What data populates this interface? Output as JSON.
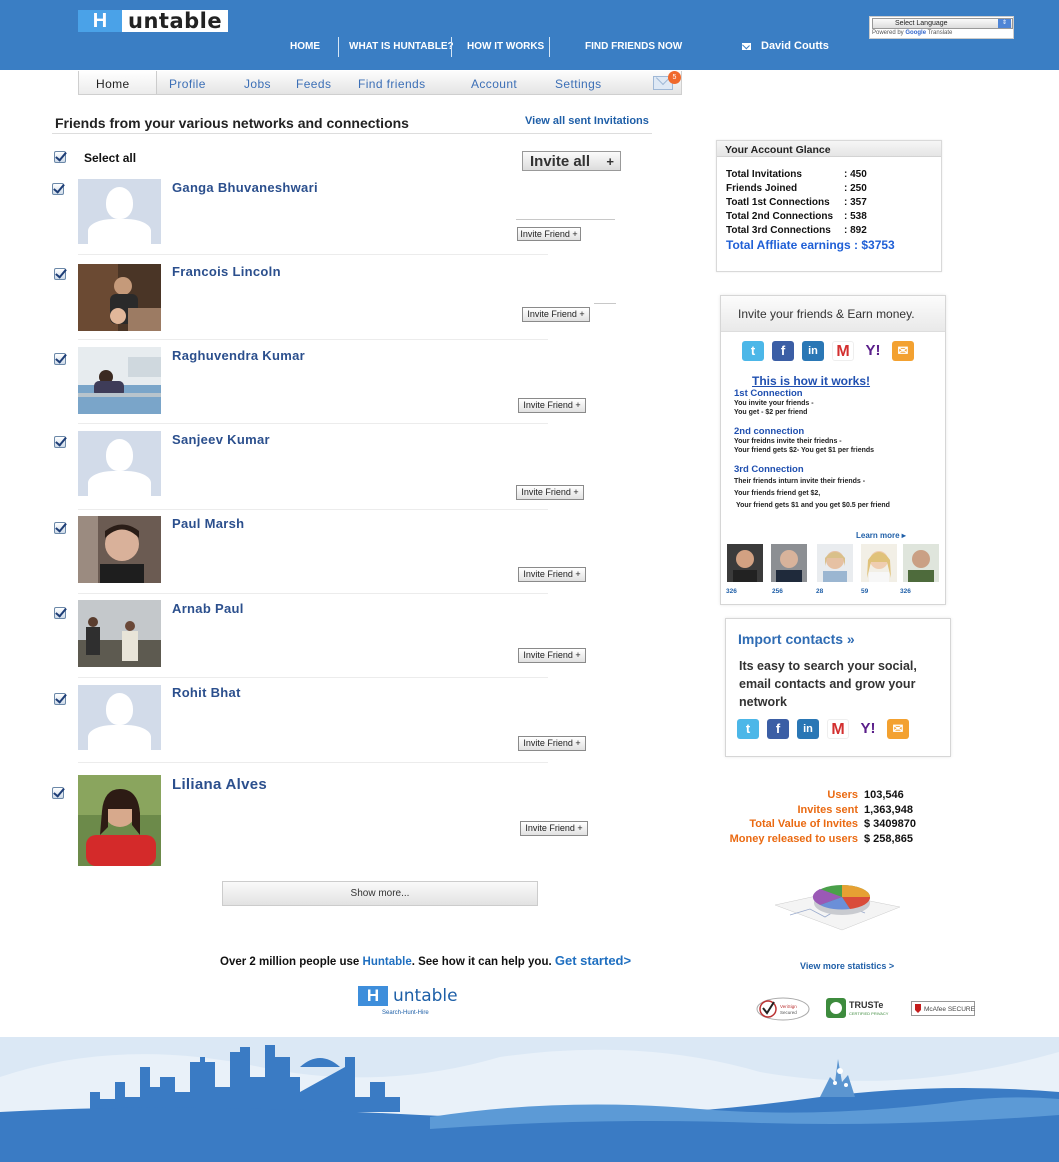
{
  "header": {
    "logo_letter": "H",
    "logo_word": "untable",
    "nav": [
      "HOME",
      "WHAT IS HUNTABLE?",
      "HOW IT WORKS",
      "FIND FRIENDS NOW"
    ],
    "user_name": "David Coutts",
    "translate_select": "Select Language",
    "translate_powered": "Powered by",
    "translate_google": "Google",
    "translate_word": "Translate"
  },
  "tabs": [
    "Home",
    "Profile",
    "Jobs",
    "Feeds",
    "Find friends",
    "Account",
    "Settings"
  ],
  "mail_badge": "5",
  "main": {
    "title": "Friends from your various networks and connections",
    "view_sent": "View all sent Invitations",
    "select_all": "Select all",
    "invite_all": "Invite all",
    "invite_all_plus": "+",
    "invite_friend": "Invite Friend +",
    "friends": [
      {
        "name": "Ganga Bhuvaneshwari",
        "photo": "placeholder"
      },
      {
        "name": "Francois Lincoln",
        "photo": "man-with-baby"
      },
      {
        "name": "Raghuvendra Kumar",
        "photo": "person-at-desk"
      },
      {
        "name": "Sanjeev Kumar",
        "photo": "placeholder"
      },
      {
        "name": "Paul Marsh",
        "photo": "man-portrait"
      },
      {
        "name": "Arnab Paul",
        "photo": "two-people-outdoors"
      },
      {
        "name": "Rohit Bhat",
        "photo": "placeholder"
      },
      {
        "name": "Liliana Alves",
        "photo": "woman-red-jacket"
      }
    ],
    "show_more": "Show more...",
    "promo_pre": "Over 2 million people use ",
    "promo_brand": "Huntable",
    "promo_post": ". See how it can help you. ",
    "promo_link": "Get started>",
    "bottom_logo_letter": "H",
    "bottom_logo_word": "untable",
    "bottom_logo_tagline": "Search-Hunt-Hire"
  },
  "glance": {
    "title": "Your Account Glance",
    "rows": [
      {
        "label": "Total Invitations",
        "value": ": 450"
      },
      {
        "label": "Friends Joined",
        "value": ": 250"
      },
      {
        "label": "Toatl 1st Connections",
        "value": ": 357"
      },
      {
        "label": "Total 2nd Connections",
        "value": ": 538"
      },
      {
        "label": "Total 3rd Connections",
        "value": ": 892"
      }
    ],
    "earnings": "Total Affliate earnings : $3753"
  },
  "earn": {
    "title": "Invite your friends & Earn money.",
    "how": "This is how it works!",
    "c1_title": "1st Connection",
    "c1_l1": "You invite your friends -",
    "c1_l2": "You get - $2 per friend",
    "c2_title": "2nd connection",
    "c2_l1": "Your freidns invite their friedns -",
    "c2_l2": "Your friend gets $2- You get $1 per friends",
    "c3_title": "3rd Connection",
    "c3_l1": "Their friends inturn invite their friends -",
    "c3_l2": "Your friends friend get $2,",
    "c3_l3": "Your friend gets $1 and you get $0.5 per friend",
    "learn": "Learn more ▸",
    "counts": [
      "326",
      "256",
      "28",
      "59",
      "326"
    ]
  },
  "import": {
    "title": "Import contacts »",
    "desc": "Its easy to search your social, email contacts and grow your network"
  },
  "social_icons": [
    "twitter-icon",
    "facebook-icon",
    "linkedin-icon",
    "gmail-icon",
    "yahoo-icon",
    "email-icon"
  ],
  "stats": [
    {
      "label": "Users",
      "value": "103,546"
    },
    {
      "label": "Invites sent",
      "value": "1,363,948"
    },
    {
      "label": "Total Value of Invites",
      "value": "$ 3409870"
    },
    {
      "label": "Money released to users",
      "value": "$ 258,865"
    }
  ],
  "view_more_stats": "View more statistics >",
  "trust": {
    "verisign": "VeriSign Secured",
    "truste": "TRUSTe",
    "truste_sub": "CERTIFIED PRIVACY",
    "mcafee": "McAfee SECURE"
  },
  "colors": {
    "brand_blue": "#3a7ec4",
    "link_blue": "#1f5fa8",
    "stat_orange": "#ea6a12"
  }
}
